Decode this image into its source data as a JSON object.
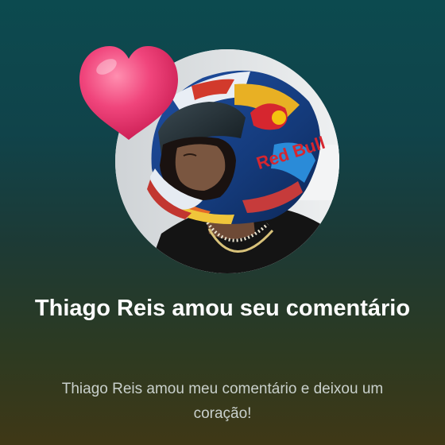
{
  "notification": {
    "title": "Thiago Reis amou seu comentário",
    "message": "Thiago Reis amou meu comentário e deixou um coração!"
  },
  "avatar": {
    "icon": "profile-photo-helmet",
    "helmet_text": "Red Bull"
  },
  "reaction": {
    "icon": "heart-icon",
    "color": "#f0457c"
  },
  "colors": {
    "background_top": "#0c4a4f",
    "background_bottom": "#3f3816",
    "title": "#ffffff",
    "message": "#c9d0cc"
  }
}
